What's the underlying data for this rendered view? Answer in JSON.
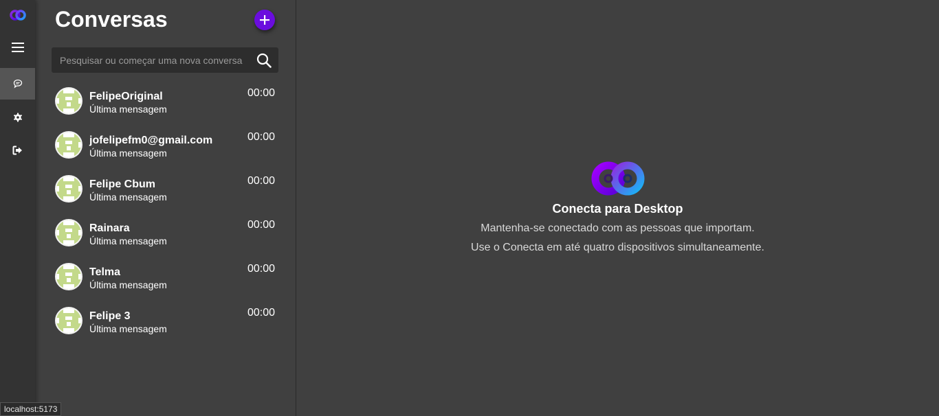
{
  "rail": {
    "logo_icon": "conecta-logo-icon",
    "items": [
      {
        "icon": "menu-icon"
      },
      {
        "icon": "chat-icon",
        "active": true
      },
      {
        "icon": "gear-icon"
      },
      {
        "icon": "logout-icon"
      }
    ]
  },
  "conversations": {
    "title": "Conversas",
    "new_button_icon": "plus-icon",
    "search": {
      "placeholder": "Pesquisar ou começar uma nova conversa"
    },
    "items": [
      {
        "name": "FelipeOriginal",
        "preview": "Última mensagem",
        "time": "00:00"
      },
      {
        "name": "jofelipefm0@gmail.com",
        "preview": "Última mensagem",
        "time": "00:00"
      },
      {
        "name": "Felipe Cbum",
        "preview": "Última mensagem",
        "time": "00:00"
      },
      {
        "name": "Rainara",
        "preview": "Última mensagem",
        "time": "00:00"
      },
      {
        "name": "Telma",
        "preview": "Última mensagem",
        "time": "00:00"
      },
      {
        "name": "Felipe 3",
        "preview": "Última mensagem",
        "time": "00:00"
      }
    ]
  },
  "welcome": {
    "title": "Conecta para Desktop",
    "line1": "Mantenha-se conectado com as pessoas que importam.",
    "line2": "Use o Conecta em até quatro dispositivos simultaneamente."
  },
  "status_bar": {
    "url": "localhost:5173"
  },
  "colors": {
    "background": "#404040",
    "rail": "#333333",
    "accent": "#6a0dde",
    "avatar_green": "#c3d98a"
  }
}
